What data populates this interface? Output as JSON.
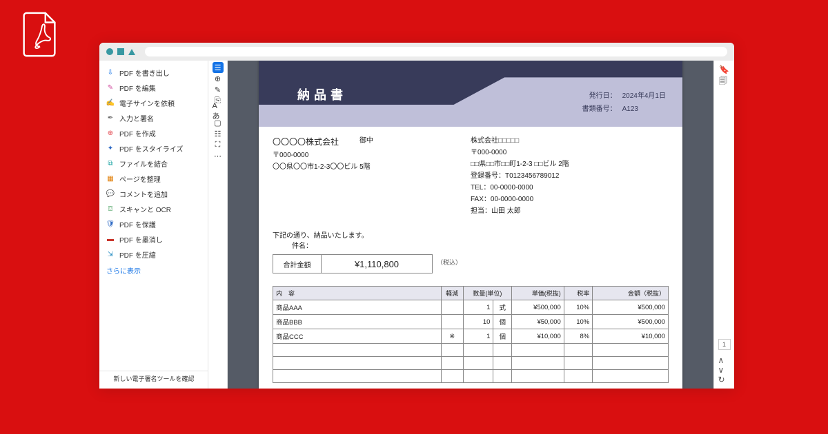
{
  "sidebar": {
    "items": [
      {
        "label": "PDF を書き出し",
        "color": "#1473e6",
        "glyph": "⇩"
      },
      {
        "label": "PDF を編集",
        "color": "#d24fa0",
        "glyph": "✎"
      },
      {
        "label": "電子サインを依頼",
        "color": "#b84aa8",
        "glyph": "✍"
      },
      {
        "label": "入力と署名",
        "color": "#6b6b6b",
        "glyph": "✒"
      },
      {
        "label": "PDF を作成",
        "color": "#e34850",
        "glyph": "⊕"
      },
      {
        "label": "PDF をスタイライズ",
        "color": "#2d69c4",
        "glyph": "✦"
      },
      {
        "label": "ファイルを結合",
        "color": "#1aa3a3",
        "glyph": "⧉"
      },
      {
        "label": "ページを整理",
        "color": "#e07b00",
        "glyph": "▦"
      },
      {
        "label": "コメントを追加",
        "color": "#4b9b3f",
        "glyph": "💬"
      },
      {
        "label": "スキャンと OCR",
        "color": "#1f8a3b",
        "glyph": "⌼"
      },
      {
        "label": "PDF を保護",
        "color": "#2d69c4",
        "glyph": "🛡"
      },
      {
        "label": "PDF を墨消し",
        "color": "#c9352b",
        "glyph": "▬"
      },
      {
        "label": "PDF を圧縮",
        "color": "#2d90c4",
        "glyph": "⇲"
      }
    ],
    "more": "さらに表示",
    "footer": "新しい電子署名ツールを確認"
  },
  "toolstrip": [
    "☰",
    "⊕",
    "✎",
    "⎘",
    "Aあ",
    "▢",
    "☷",
    "⛶",
    "⋯"
  ],
  "rightRail": {
    "top": [
      "🔖",
      "🗐"
    ],
    "pageNum": "1",
    "bottom": [
      "∧",
      "∨",
      "↻"
    ]
  },
  "doc": {
    "title": "納品書",
    "issueLabel": "発行日：",
    "issueDate": "2024年4月1日",
    "docNoLabel": "書類番号：",
    "docNo": "A123",
    "client": {
      "name": "〇〇〇〇株式会社",
      "honor": "御中",
      "postal": "〒000-0000",
      "addr": "〇〇県〇〇市1-2-3〇〇ビル 5階"
    },
    "sender": {
      "name": "株式会社□□□□□",
      "postal": "〒000-0000",
      "addr": "□□県□□市□□町1-2-3 □□ビル 2階",
      "regLabel": "登録番号：",
      "reg": "T0123456789012",
      "telLabel": "TEL：",
      "tel": "00-0000-0000",
      "faxLabel": "FAX：",
      "fax": "00-0000-0000",
      "personLabel": "担当：",
      "person": "山田 太郎"
    },
    "note": "下記の通り、納品いたします。",
    "subjectLabel": "件名：",
    "totalLabel": "合計金額",
    "totalValue": "¥1,110,800",
    "totalTax": "（税込）",
    "columns": {
      "desc": "内　容",
      "kg": "軽減",
      "qty": "数量(単位)",
      "price": "単価(税抜)",
      "rate": "税率",
      "amt": "金額（税抜）"
    },
    "items": [
      {
        "desc": "商品AAA",
        "kg": "",
        "qty": "1",
        "unit": "式",
        "price": "¥500,000",
        "rate": "10%",
        "amt": "¥500,000"
      },
      {
        "desc": "商品BBB",
        "kg": "",
        "qty": "10",
        "unit": "個",
        "price": "¥50,000",
        "rate": "10%",
        "amt": "¥500,000"
      },
      {
        "desc": "商品CCC",
        "kg": "※",
        "qty": "1",
        "unit": "個",
        "price": "¥10,000",
        "rate": "8%",
        "amt": "¥10,000"
      },
      {
        "desc": "",
        "kg": "",
        "qty": "",
        "unit": "",
        "price": "",
        "rate": "",
        "amt": ""
      },
      {
        "desc": "",
        "kg": "",
        "qty": "",
        "unit": "",
        "price": "",
        "rate": "",
        "amt": ""
      },
      {
        "desc": "",
        "kg": "",
        "qty": "",
        "unit": "",
        "price": "",
        "rate": "",
        "amt": ""
      }
    ]
  }
}
